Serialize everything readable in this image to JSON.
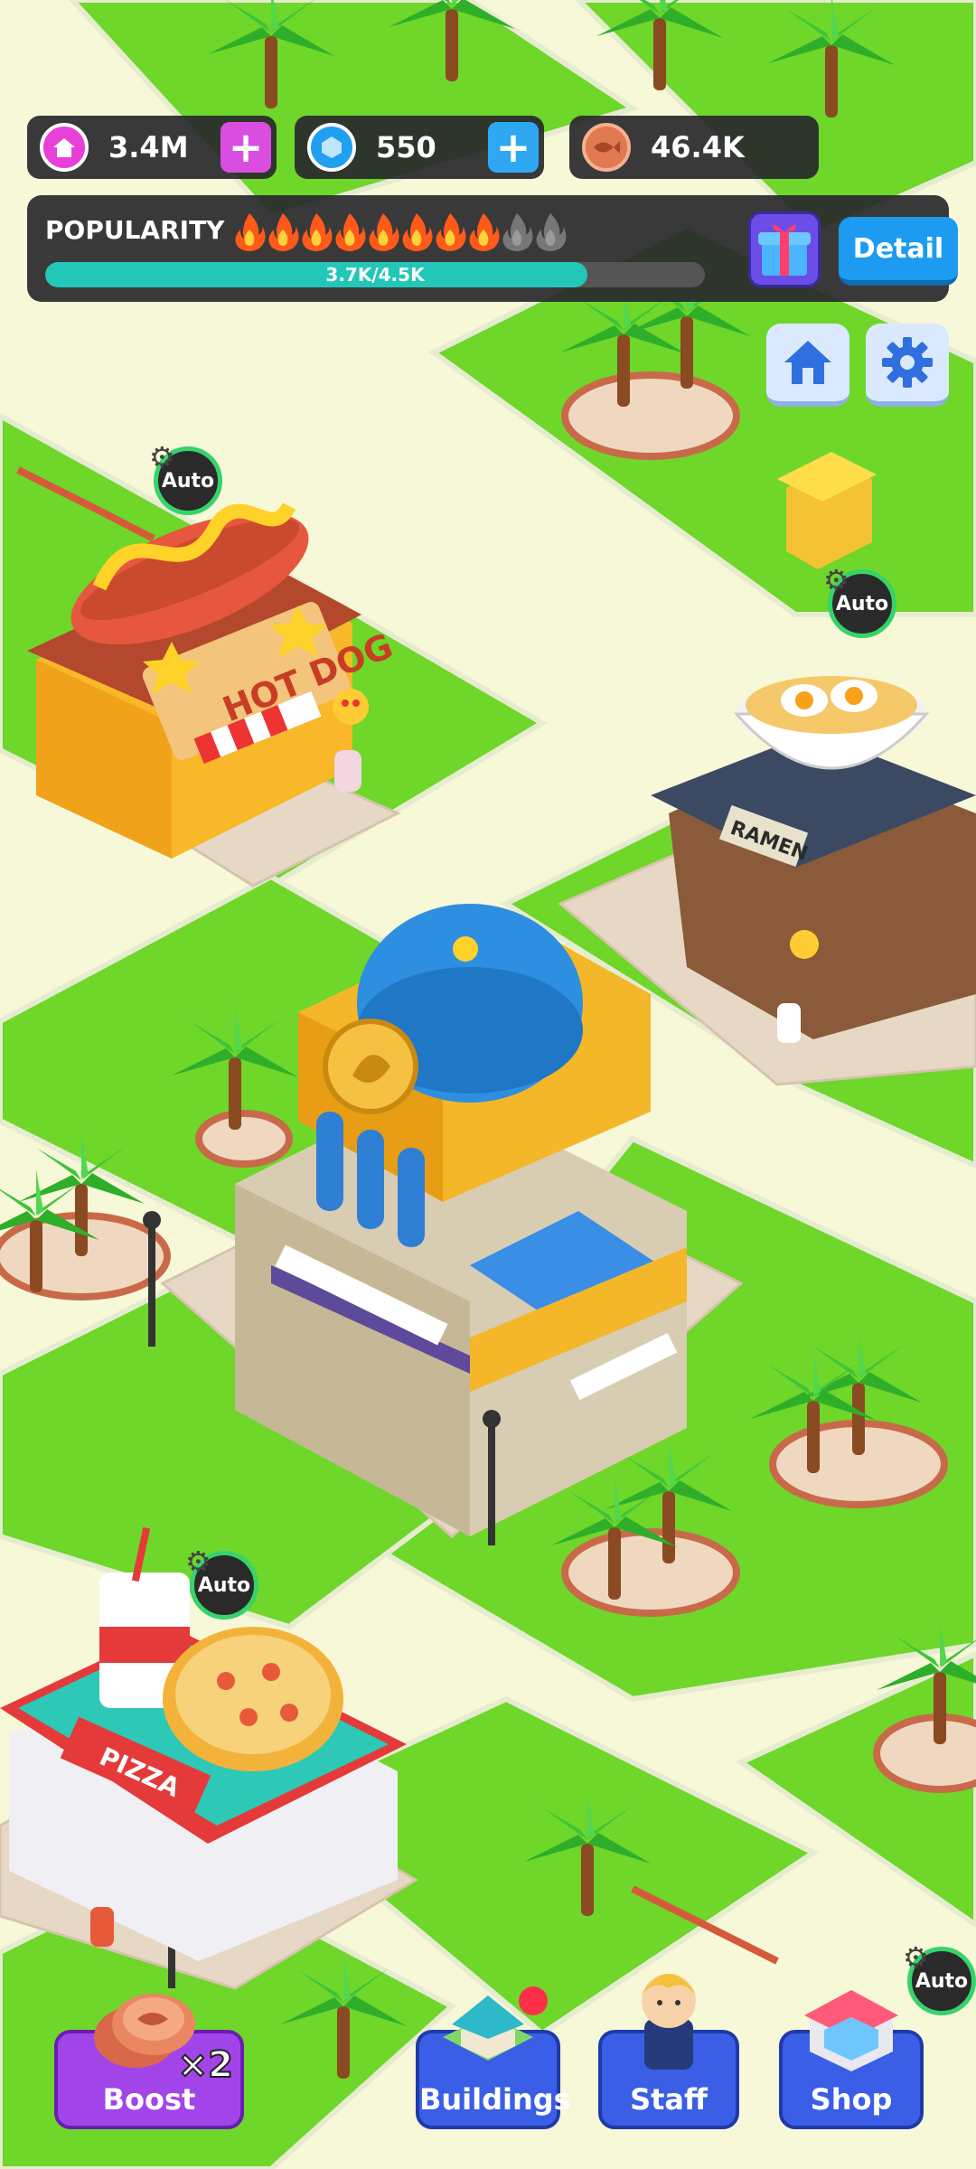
{
  "resources": {
    "cash": {
      "value": "3.4M",
      "icon": "house-coin-icon"
    },
    "gems": {
      "value": "550",
      "icon": "gem-icon"
    },
    "fish": {
      "value": "46.4K",
      "icon": "fish-coin-icon"
    }
  },
  "popularity": {
    "label": "POPULARITY",
    "progress_text": "3.7K/4.5K",
    "current": 3700,
    "max": 4500,
    "flames_total": 10,
    "flames_lit": 8,
    "detail_label": "Detail"
  },
  "auto_label": "Auto",
  "buildings": {
    "hotdog_sign": "HOT DOG",
    "ramen_sign": "RAMEN",
    "pizza_sign": "PIZZA"
  },
  "nav": {
    "boost": {
      "label": "Boost",
      "badge": "×2"
    },
    "buildings": {
      "label": "Buildings"
    },
    "staff": {
      "label": "Staff"
    },
    "shop": {
      "label": "Shop"
    }
  },
  "colors": {
    "grass": "#6fd62a",
    "path": "#f7f8d8",
    "accent_blue": "#1d9bf0",
    "popularity_fill": "#22c7b8",
    "nav_purple": "#7a4ae8",
    "nav_blue": "#3a5ee6"
  }
}
